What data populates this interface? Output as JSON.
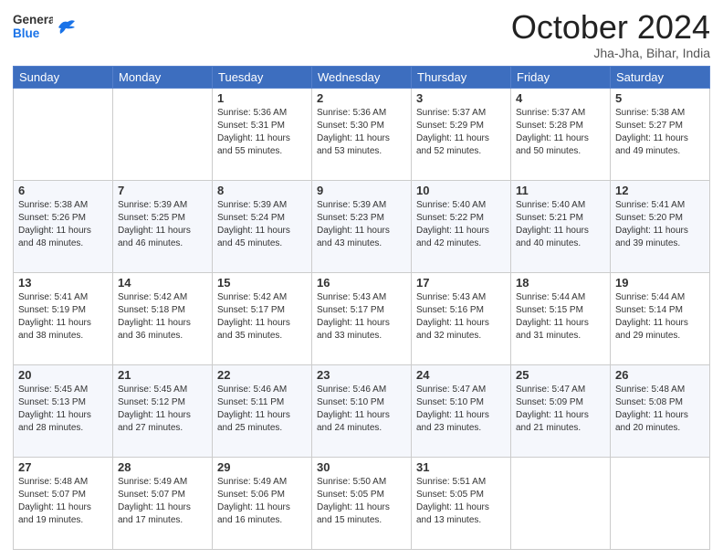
{
  "header": {
    "logo_text_general": "General",
    "logo_text_blue": "Blue",
    "month": "October 2024",
    "location": "Jha-Jha, Bihar, India"
  },
  "weekdays": [
    "Sunday",
    "Monday",
    "Tuesday",
    "Wednesday",
    "Thursday",
    "Friday",
    "Saturday"
  ],
  "weeks": [
    [
      null,
      null,
      {
        "day": 1,
        "sunrise": "5:36 AM",
        "sunset": "5:31 PM",
        "daylight": "11 hours and 55 minutes."
      },
      {
        "day": 2,
        "sunrise": "5:36 AM",
        "sunset": "5:30 PM",
        "daylight": "11 hours and 53 minutes."
      },
      {
        "day": 3,
        "sunrise": "5:37 AM",
        "sunset": "5:29 PM",
        "daylight": "11 hours and 52 minutes."
      },
      {
        "day": 4,
        "sunrise": "5:37 AM",
        "sunset": "5:28 PM",
        "daylight": "11 hours and 50 minutes."
      },
      {
        "day": 5,
        "sunrise": "5:38 AM",
        "sunset": "5:27 PM",
        "daylight": "11 hours and 49 minutes."
      }
    ],
    [
      {
        "day": 6,
        "sunrise": "5:38 AM",
        "sunset": "5:26 PM",
        "daylight": "11 hours and 48 minutes."
      },
      {
        "day": 7,
        "sunrise": "5:39 AM",
        "sunset": "5:25 PM",
        "daylight": "11 hours and 46 minutes."
      },
      {
        "day": 8,
        "sunrise": "5:39 AM",
        "sunset": "5:24 PM",
        "daylight": "11 hours and 45 minutes."
      },
      {
        "day": 9,
        "sunrise": "5:39 AM",
        "sunset": "5:23 PM",
        "daylight": "11 hours and 43 minutes."
      },
      {
        "day": 10,
        "sunrise": "5:40 AM",
        "sunset": "5:22 PM",
        "daylight": "11 hours and 42 minutes."
      },
      {
        "day": 11,
        "sunrise": "5:40 AM",
        "sunset": "5:21 PM",
        "daylight": "11 hours and 40 minutes."
      },
      {
        "day": 12,
        "sunrise": "5:41 AM",
        "sunset": "5:20 PM",
        "daylight": "11 hours and 39 minutes."
      }
    ],
    [
      {
        "day": 13,
        "sunrise": "5:41 AM",
        "sunset": "5:19 PM",
        "daylight": "11 hours and 38 minutes."
      },
      {
        "day": 14,
        "sunrise": "5:42 AM",
        "sunset": "5:18 PM",
        "daylight": "11 hours and 36 minutes."
      },
      {
        "day": 15,
        "sunrise": "5:42 AM",
        "sunset": "5:17 PM",
        "daylight": "11 hours and 35 minutes."
      },
      {
        "day": 16,
        "sunrise": "5:43 AM",
        "sunset": "5:17 PM",
        "daylight": "11 hours and 33 minutes."
      },
      {
        "day": 17,
        "sunrise": "5:43 AM",
        "sunset": "5:16 PM",
        "daylight": "11 hours and 32 minutes."
      },
      {
        "day": 18,
        "sunrise": "5:44 AM",
        "sunset": "5:15 PM",
        "daylight": "11 hours and 31 minutes."
      },
      {
        "day": 19,
        "sunrise": "5:44 AM",
        "sunset": "5:14 PM",
        "daylight": "11 hours and 29 minutes."
      }
    ],
    [
      {
        "day": 20,
        "sunrise": "5:45 AM",
        "sunset": "5:13 PM",
        "daylight": "11 hours and 28 minutes."
      },
      {
        "day": 21,
        "sunrise": "5:45 AM",
        "sunset": "5:12 PM",
        "daylight": "11 hours and 27 minutes."
      },
      {
        "day": 22,
        "sunrise": "5:46 AM",
        "sunset": "5:11 PM",
        "daylight": "11 hours and 25 minutes."
      },
      {
        "day": 23,
        "sunrise": "5:46 AM",
        "sunset": "5:10 PM",
        "daylight": "11 hours and 24 minutes."
      },
      {
        "day": 24,
        "sunrise": "5:47 AM",
        "sunset": "5:10 PM",
        "daylight": "11 hours and 23 minutes."
      },
      {
        "day": 25,
        "sunrise": "5:47 AM",
        "sunset": "5:09 PM",
        "daylight": "11 hours and 21 minutes."
      },
      {
        "day": 26,
        "sunrise": "5:48 AM",
        "sunset": "5:08 PM",
        "daylight": "11 hours and 20 minutes."
      }
    ],
    [
      {
        "day": 27,
        "sunrise": "5:48 AM",
        "sunset": "5:07 PM",
        "daylight": "11 hours and 19 minutes."
      },
      {
        "day": 28,
        "sunrise": "5:49 AM",
        "sunset": "5:07 PM",
        "daylight": "11 hours and 17 minutes."
      },
      {
        "day": 29,
        "sunrise": "5:49 AM",
        "sunset": "5:06 PM",
        "daylight": "11 hours and 16 minutes."
      },
      {
        "day": 30,
        "sunrise": "5:50 AM",
        "sunset": "5:05 PM",
        "daylight": "11 hours and 15 minutes."
      },
      {
        "day": 31,
        "sunrise": "5:51 AM",
        "sunset": "5:05 PM",
        "daylight": "11 hours and 13 minutes."
      },
      null,
      null
    ]
  ]
}
